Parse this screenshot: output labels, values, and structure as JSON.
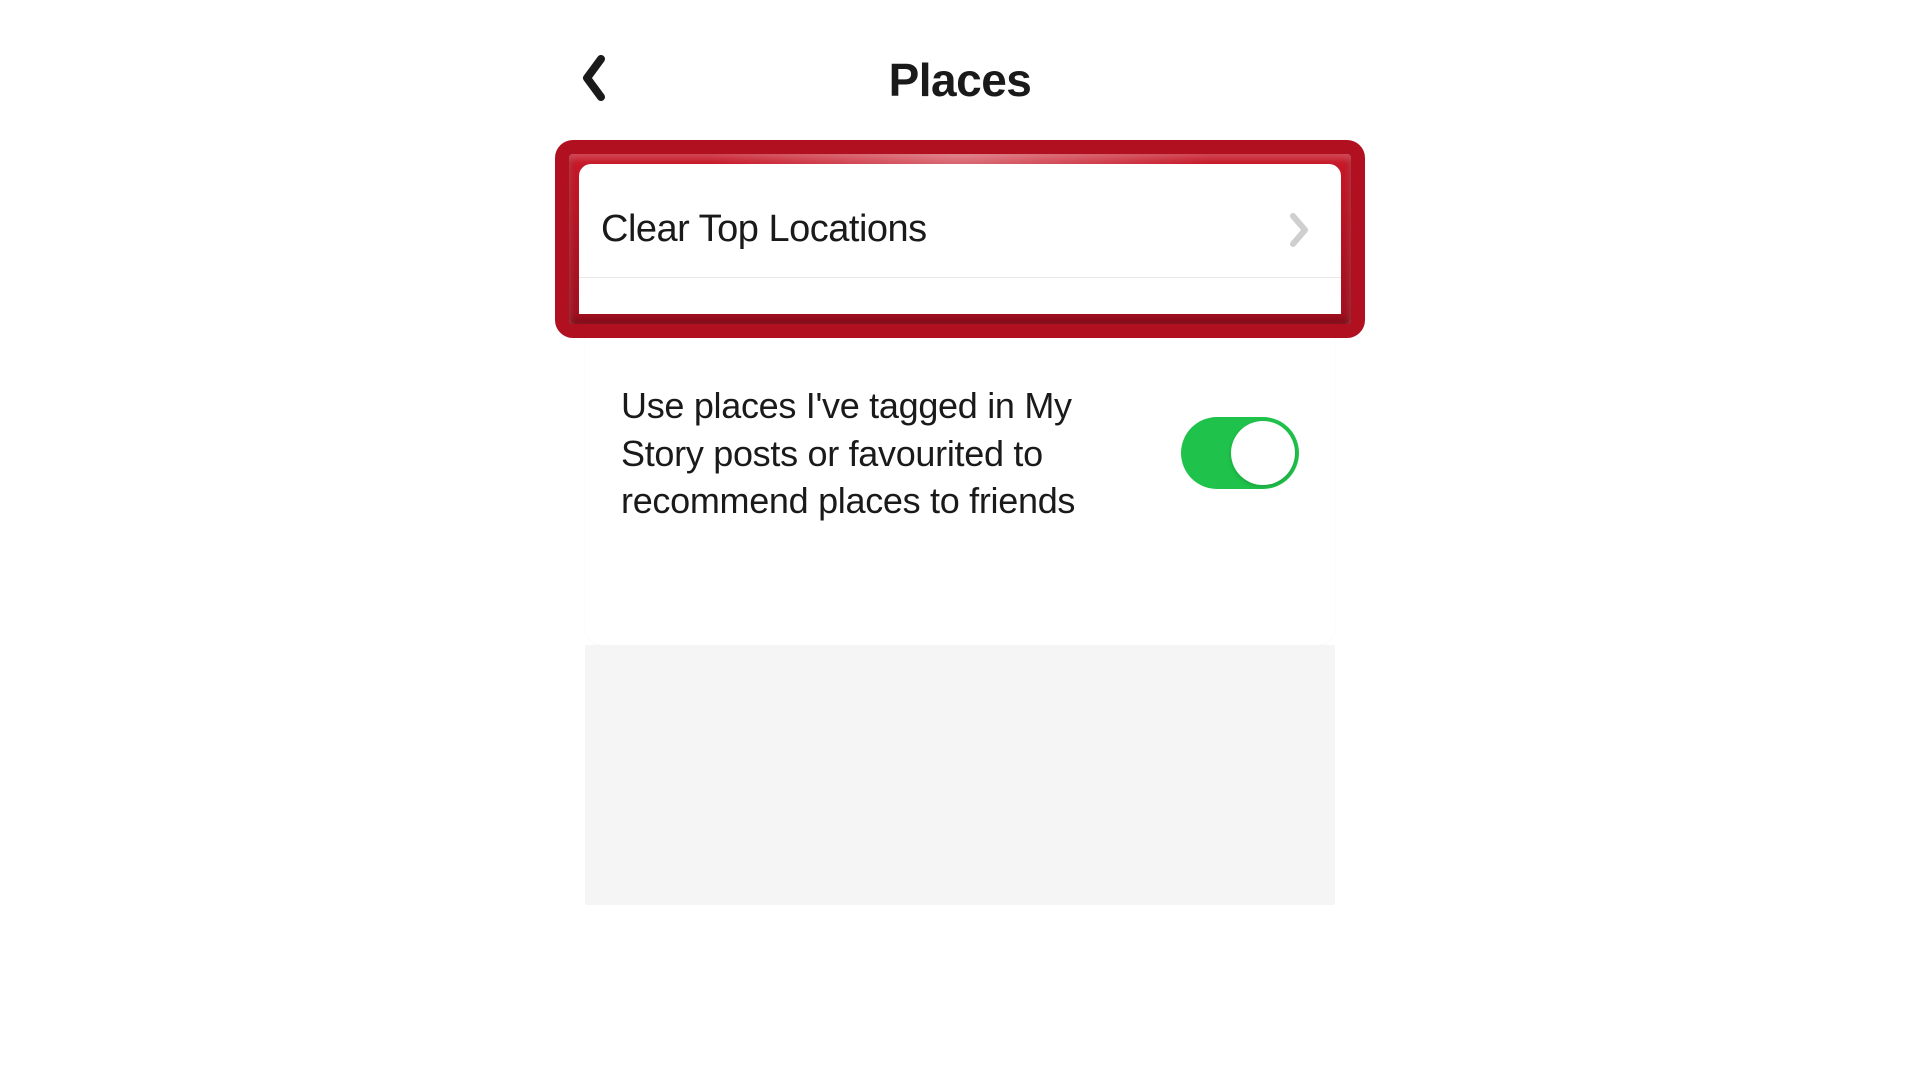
{
  "header": {
    "title": "Places"
  },
  "rows": {
    "clear_top_locations": {
      "label": "Clear Top Locations"
    },
    "recommend_toggle": {
      "label": "Use places I've tagged in My Story posts or favourited to recommend places to friends",
      "enabled": true
    }
  },
  "colors": {
    "highlight_border": "#b01020",
    "toggle_on": "#1fc24a"
  }
}
